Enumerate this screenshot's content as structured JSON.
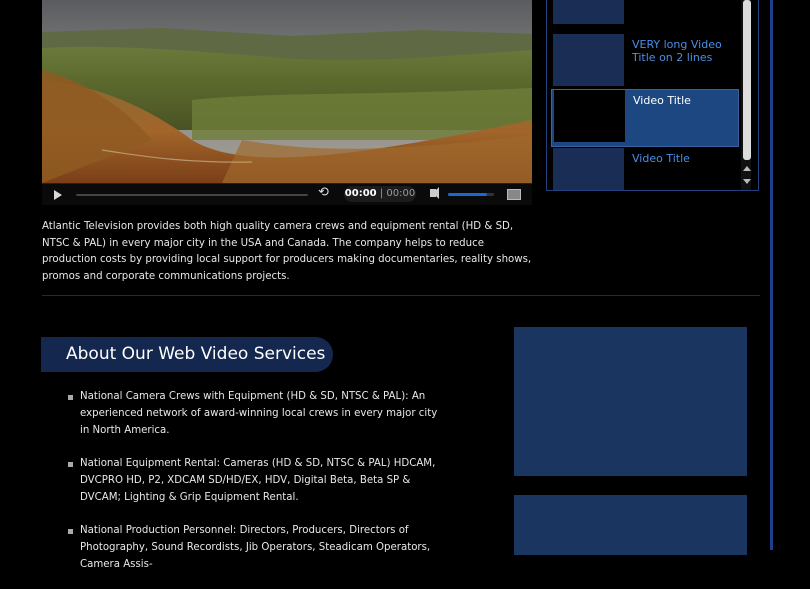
{
  "player": {
    "time_current": "00:00",
    "time_separator": "|",
    "time_total": "00:00",
    "volume_level": 0.85
  },
  "playlist": {
    "items": [
      {
        "title": ""
      },
      {
        "title": "VERY long Video Title on 2 lines"
      },
      {
        "title": "Video Title",
        "active": true
      },
      {
        "title": "Video Title"
      }
    ]
  },
  "intro": {
    "text": "Atlantic Television provides both high quality camera crews and equipment rental (HD & SD, NTSC & PAL) in every major city in the USA and Canada. The company helps to reduce production costs by providing local support for producers making documentaries, reality shows, promos and corporate communications projects."
  },
  "about": {
    "heading": "About Our Web Video Services",
    "items": [
      "National Camera Crews with Equipment (HD & SD, NTSC & PAL): An experienced network of award-winning local crews in every major city in North America.",
      "National Equipment Rental: Cameras (HD & SD, NTSC & PAL) HDCAM, DVCPRO HD, P2, XDCAM SD/HD/EX, HDV, Digital Beta, Beta SP & DVCAM; Lighting & Grip Equipment Rental.",
      "National Production Personnel: Directors, Producers, Directors of Photography, Sound Recordists, Jib Operators, Steadicam Operators, Camera Assis-"
    ]
  },
  "colors": {
    "accent": "#1f3f8e",
    "playlist_active": "#1d4781",
    "link": "#4b8ee8",
    "pill": "#14284f"
  }
}
